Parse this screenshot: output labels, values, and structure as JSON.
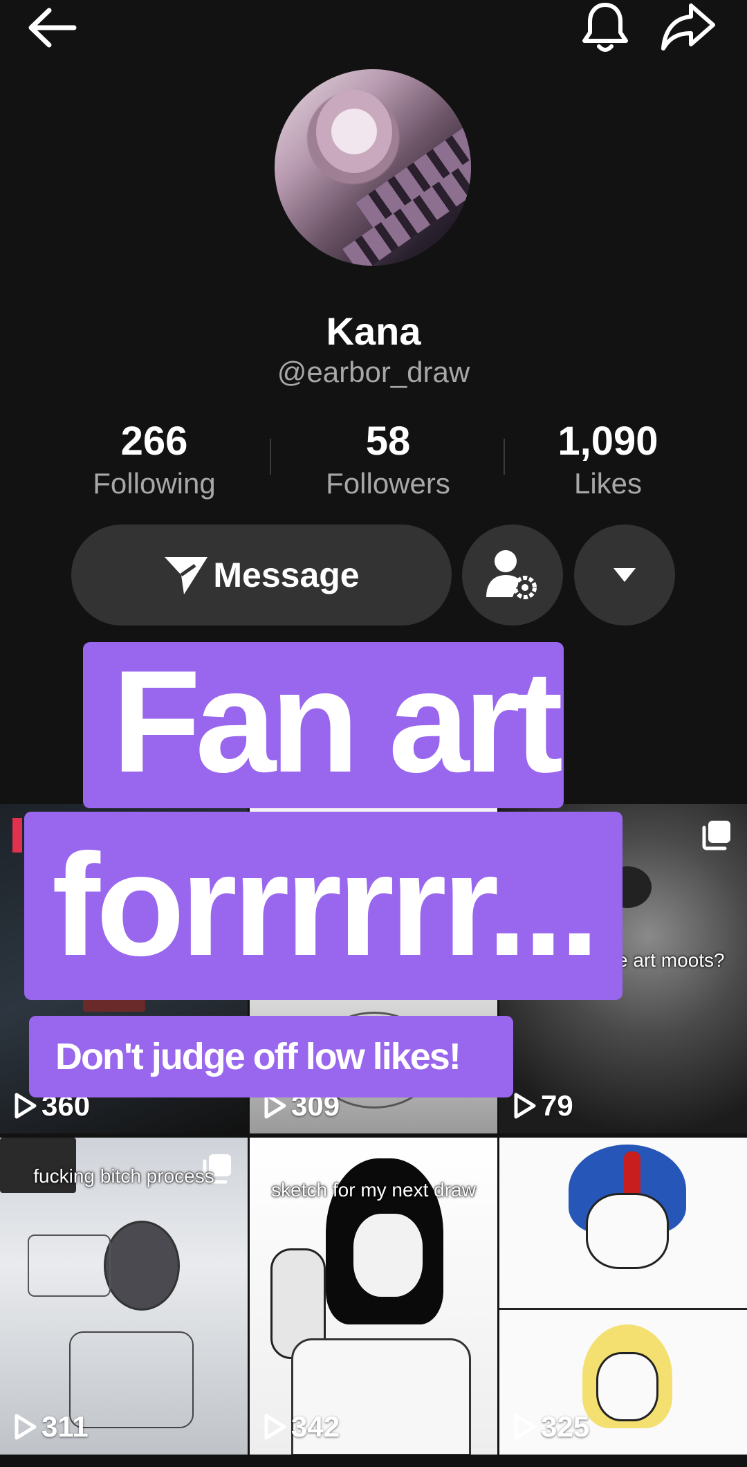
{
  "profile": {
    "name": "Kana",
    "handle": "@earbor_draw"
  },
  "stats": {
    "following": {
      "value": "266",
      "label": "Following"
    },
    "followers": {
      "value": "58",
      "label": "Followers"
    },
    "likes": {
      "value": "1,090",
      "label": "Likes"
    }
  },
  "actions": {
    "message_label": "Message"
  },
  "overlay": {
    "title_line1": "Fan art",
    "title_line2": "forrrrrr...",
    "subtitle": "Don't judge off low likes!"
  },
  "videos": [
    {
      "views": "360",
      "caption": ""
    },
    {
      "views": "309",
      "caption": ""
    },
    {
      "views": "79",
      "caption": "e art moots?"
    },
    {
      "views": "311",
      "caption": "fucking bitch process"
    },
    {
      "views": "342",
      "caption": "sketch for my next draw"
    },
    {
      "views": "325",
      "caption": ""
    }
  ],
  "icons": {
    "back": "arrow-left-icon",
    "bell": "bell-icon",
    "share": "share-icon",
    "message": "send-icon",
    "friend_settings": "person-gear-icon",
    "more": "caret-down-icon",
    "play": "play-icon",
    "multi": "multi-image-icon"
  },
  "colors": {
    "background": "#121212",
    "button": "#333333",
    "overlay_purple": "#9966ee",
    "muted_text": "#a8a8a8"
  }
}
